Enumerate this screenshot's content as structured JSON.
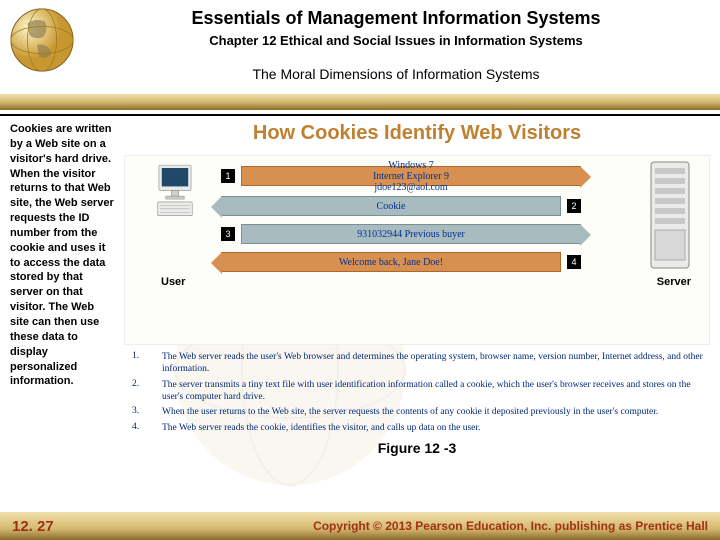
{
  "header": {
    "title": "Essentials of Management Information Systems",
    "subtitle": "Chapter 12 Ethical and Social Issues in Information Systems",
    "section": "The Moral Dimensions of Information Systems"
  },
  "sidebar": {
    "text": "Cookies are written by a Web site on a visitor's hard drive. When the visitor returns to that Web site, the Web server requests the ID number from the cookie and uses it to access the data stored by that server on that visitor. The Web site can then use these data to display personalized information."
  },
  "main": {
    "title": "How Cookies Identify Web Visitors",
    "diagram": {
      "user_label": "User",
      "server_label": "Server",
      "rows": [
        {
          "num": "1",
          "text": "Windows 7\nInternet Explorer 9\njdoe123@aol.com"
        },
        {
          "num": "2",
          "text": "Cookie"
        },
        {
          "num": "3",
          "text": "931032944 Previous buyer"
        },
        {
          "num": "4",
          "text": "Welcome back, Jane Doe!"
        }
      ]
    },
    "steps": [
      {
        "n": "1.",
        "t": "The Web server reads the user's Web browser and determines the operating system, browser name, version number, Internet address, and other information."
      },
      {
        "n": "2.",
        "t": "The server transmits a tiny text file with user identification information called a cookie, which the user's browser receives and stores on the user's computer hard drive."
      },
      {
        "n": "3.",
        "t": "When the user returns to the Web site, the server requests the contents of any cookie it deposited previously in the user's computer."
      },
      {
        "n": "4.",
        "t": "The Web server reads the cookie, identifies the visitor, and calls up data on the user."
      }
    ],
    "figure_label": "Figure 12 -3"
  },
  "footer": {
    "slide_number": "12. 27",
    "copyright": "Copyright © 2013 Pearson Education, Inc. publishing as Prentice Hall"
  }
}
